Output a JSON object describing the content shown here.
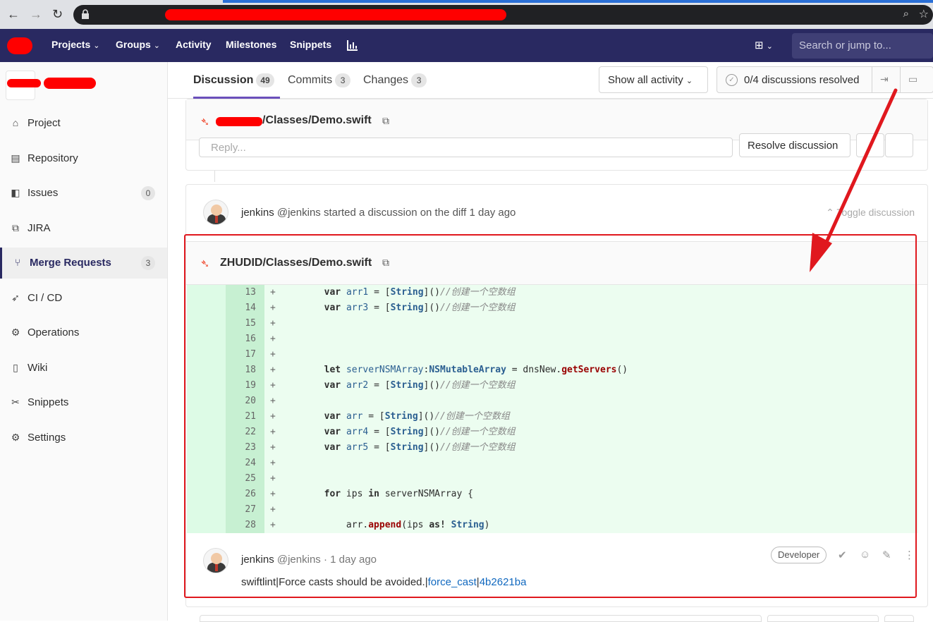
{
  "browser": {
    "back": "←",
    "forward": "→",
    "reload": "↻"
  },
  "header": {
    "nav": [
      {
        "label": "Projects",
        "caret": true
      },
      {
        "label": "Groups",
        "caret": true
      },
      {
        "label": "Activity",
        "caret": false
      },
      {
        "label": "Milestones",
        "caret": false
      },
      {
        "label": "Snippets",
        "caret": false
      }
    ],
    "search_placeholder": "Search or jump to..."
  },
  "sidebar": {
    "items": [
      {
        "label": "Project",
        "icon": "home-icon",
        "glyph": "⌂"
      },
      {
        "label": "Repository",
        "icon": "doc-icon",
        "glyph": "▤"
      },
      {
        "label": "Issues",
        "icon": "issues-icon",
        "glyph": "◧",
        "count": "0"
      },
      {
        "label": "JIRA",
        "icon": "jira-icon",
        "glyph": "⧉"
      },
      {
        "label": "Merge Requests",
        "icon": "merge-icon",
        "glyph": "⑂",
        "count": "3",
        "active": true
      },
      {
        "label": "CI / CD",
        "icon": "rocket-icon",
        "glyph": "➶"
      },
      {
        "label": "Operations",
        "icon": "cloud-gear-icon",
        "glyph": "⚙"
      },
      {
        "label": "Wiki",
        "icon": "book-icon",
        "glyph": "▯"
      },
      {
        "label": "Snippets",
        "icon": "scissors-icon",
        "glyph": "✂"
      },
      {
        "label": "Settings",
        "icon": "gear-icon",
        "glyph": "⚙"
      }
    ]
  },
  "tabs": {
    "discussion": {
      "label": "Discussion",
      "count": "49"
    },
    "commits": {
      "label": "Commits",
      "count": "3"
    },
    "changes": {
      "label": "Changes",
      "count": "3"
    },
    "activity_filter": "Show all activity",
    "resolved": "0/4 discussions resolved"
  },
  "discussion1": {
    "file": "/Classes/Demo.swift",
    "reply_placeholder": "Reply...",
    "resolve_label": "Resolve discussion"
  },
  "discussion2": {
    "author": "jenkins",
    "handle": "@jenkins",
    "action": "started a discussion on the diff",
    "time": "1 day ago",
    "toggle": "Toggle discussion",
    "file": "ZHUDID/Classes/Demo.swift"
  },
  "diff_lines": [
    {
      "no": "13",
      "html": "<span class='kw'>var</span> <span class='var'>arr1</span> = [<span class='ty'>String</span>]()<span class='cm'>//创建一个空数组</span>"
    },
    {
      "no": "14",
      "html": "<span class='kw'>var</span> <span class='var'>arr3</span> = [<span class='ty'>String</span>]()<span class='cm'>//创建一个空数组</span>"
    },
    {
      "no": "15",
      "html": ""
    },
    {
      "no": "16",
      "html": ""
    },
    {
      "no": "17",
      "html": ""
    },
    {
      "no": "18",
      "html": "<span class='kw'>let</span> <span class='var'>serverNSMArray</span>:<span class='ty'>NSMutableArray</span> = dnsNew.<span class='fn'>getServers</span>()"
    },
    {
      "no": "19",
      "html": "<span class='kw'>var</span> <span class='var'>arr2</span> = [<span class='ty'>String</span>]()<span class='cm'>//创建一个空数组</span>"
    },
    {
      "no": "20",
      "html": ""
    },
    {
      "no": "21",
      "html": "<span class='kw'>var</span> <span class='var'>arr</span> = [<span class='ty'>String</span>]()<span class='cm'>//创建一个空数组</span>"
    },
    {
      "no": "22",
      "html": "<span class='kw'>var</span> <span class='var'>arr4</span> = [<span class='ty'>String</span>]()<span class='cm'>//创建一个空数组</span>"
    },
    {
      "no": "23",
      "html": "<span class='kw'>var</span> <span class='var'>arr5</span> = [<span class='ty'>String</span>]()<span class='cm'>//创建一个空数组</span>"
    },
    {
      "no": "24",
      "html": ""
    },
    {
      "no": "25",
      "html": ""
    },
    {
      "no": "26",
      "html": "<span class='kw'>for</span> ips <span class='kw'>in</span> serverNSMArray {"
    },
    {
      "no": "27",
      "html": ""
    },
    {
      "no": "28",
      "html": "    arr.<span class='fn'>append</span>(ips <span class='kw'>as!</span> <span class='ty'>String</span>)"
    }
  ],
  "note": {
    "author": "jenkins",
    "handle": "@jenkins",
    "sep": "·",
    "time": "1 day ago",
    "role": "Developer",
    "body_prefix": "swiftlint|Force casts should be avoided.|",
    "link1": "force_cast",
    "sep2": "|",
    "link2": "4b2621ba"
  },
  "colors": {
    "header_bg": "#292961",
    "diff_bg": "#ecfdf0",
    "highlight": "#e0181e"
  }
}
